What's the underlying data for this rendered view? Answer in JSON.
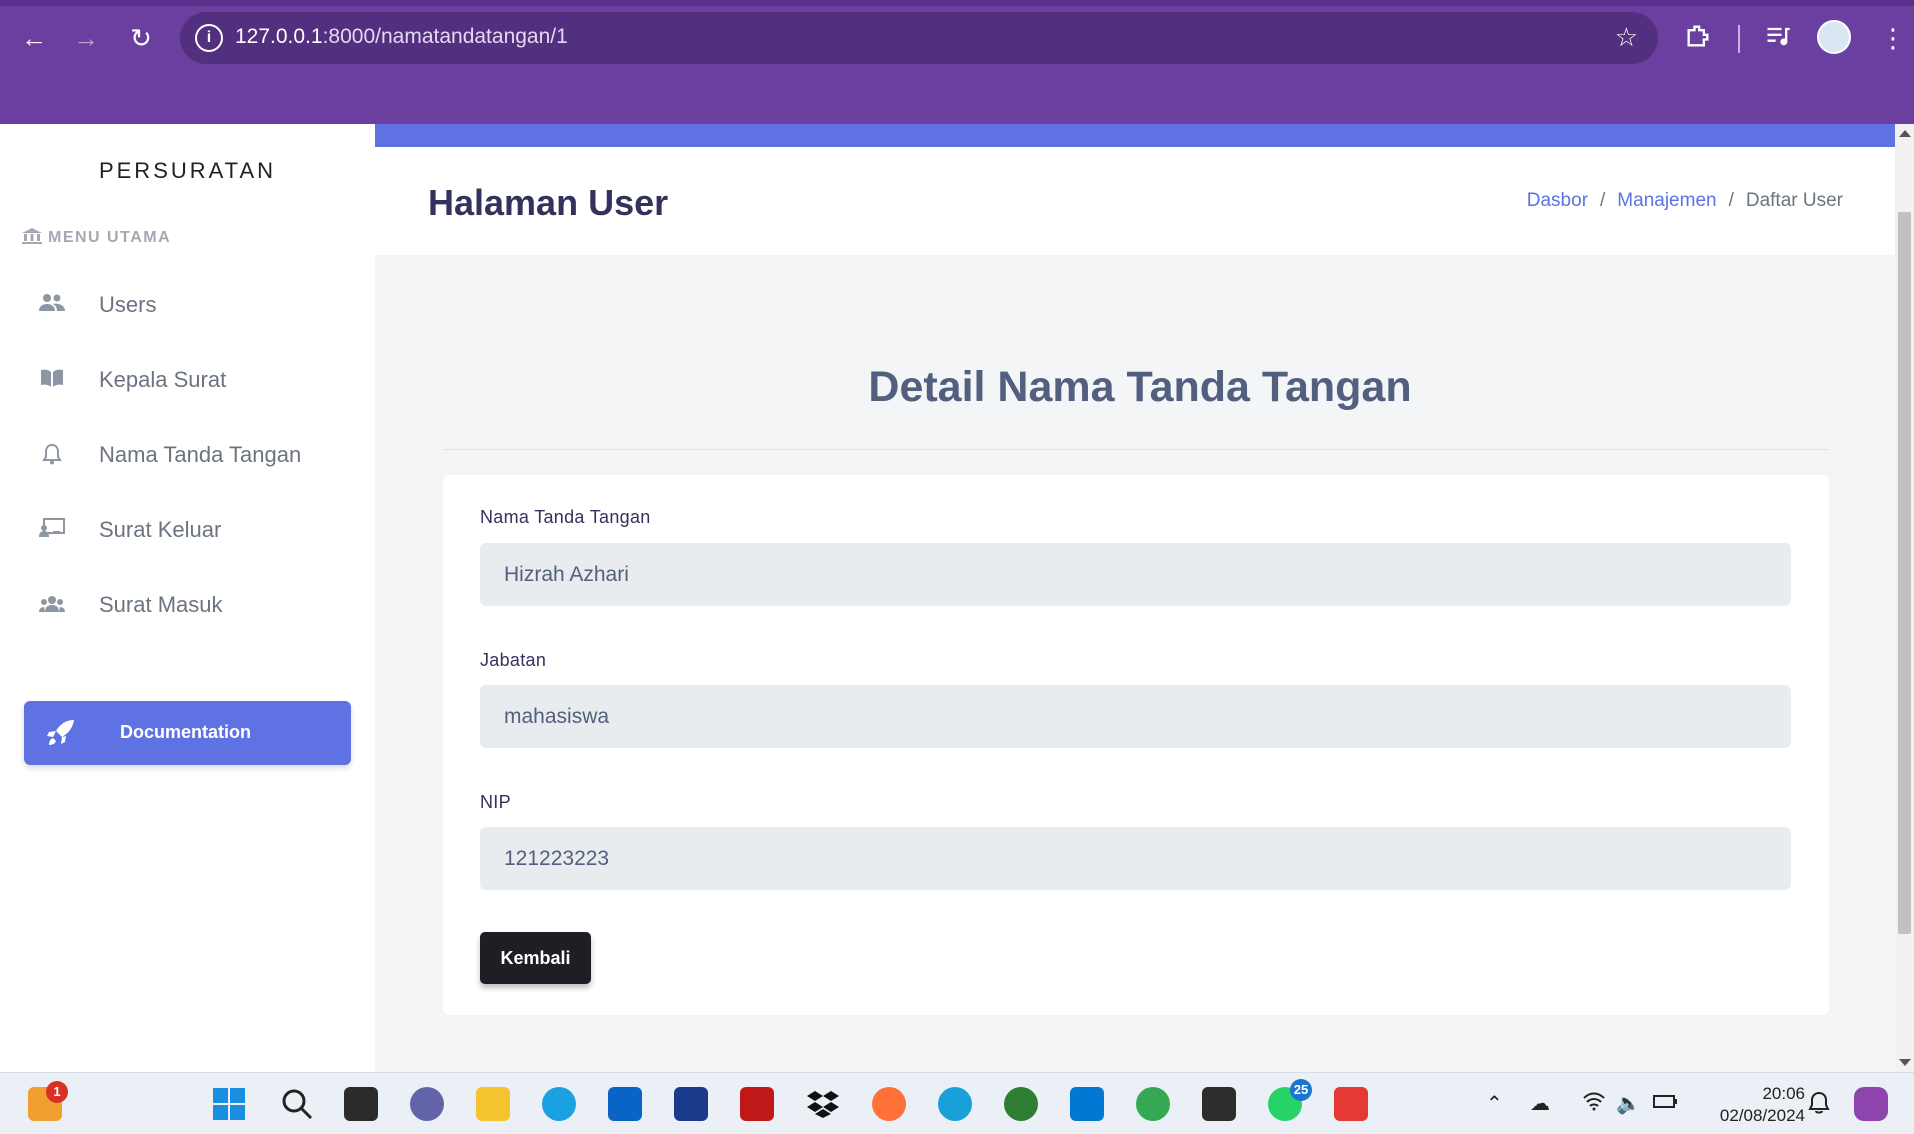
{
  "browser": {
    "url_host": "127.0.0.1",
    "url_path": ":8000/namatandatangan/1"
  },
  "sidebar": {
    "brand": "PERSURATAN",
    "menu_heading": "MENU UTAMA",
    "items": [
      {
        "label": "Users",
        "icon": "users-icon"
      },
      {
        "label": "Kepala Surat",
        "icon": "book-icon"
      },
      {
        "label": "Nama Tanda Tangan",
        "icon": "bell-icon"
      },
      {
        "label": "Surat Keluar",
        "icon": "chalkboard-icon"
      },
      {
        "label": "Surat Masuk",
        "icon": "group-icon"
      }
    ],
    "doc_button": "Documentation"
  },
  "header": {
    "title": "Halaman User",
    "breadcrumb": [
      "Dasbor",
      "Manajemen",
      "Daftar User"
    ]
  },
  "main": {
    "section_title": "Detail Nama Tanda Tangan",
    "fields": [
      {
        "label": "Nama Tanda Tangan",
        "value": "Hizrah Azhari"
      },
      {
        "label": "Jabatan",
        "value": "mahasiswa"
      },
      {
        "label": "NIP",
        "value": "121223223"
      }
    ],
    "back_button": "Kembali"
  },
  "taskbar": {
    "time": "20:06",
    "date": "02/08/2024",
    "badge_left": "1",
    "badge_whatsapp": "25"
  },
  "colors": {
    "browser_chrome": "#6b3fa0",
    "accent": "#5e72e4",
    "heading": "#32325d"
  }
}
